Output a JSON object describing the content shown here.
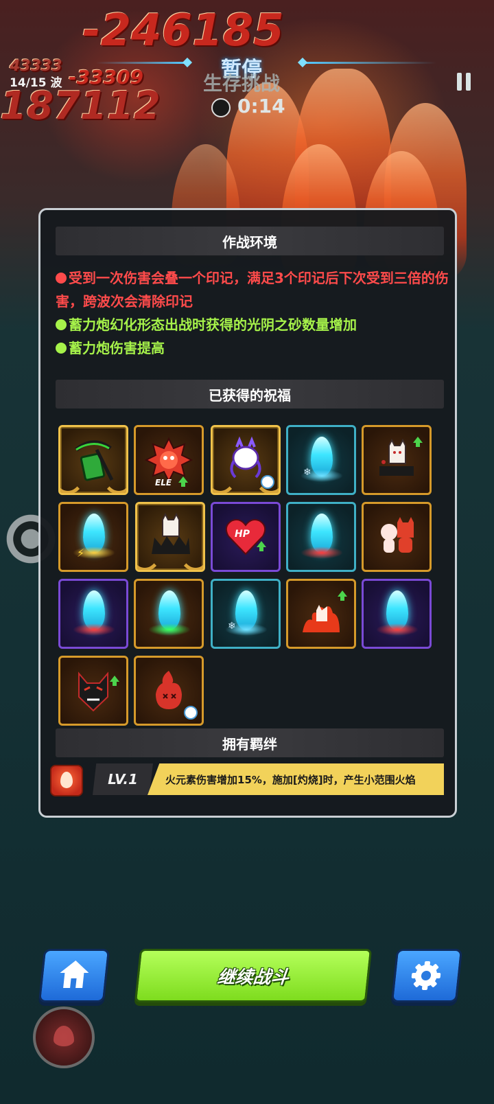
{
  "hud": {
    "damage_top": "-246185",
    "damage_left": "187112",
    "damage_small": "-33309",
    "damage_small2": "43333",
    "wave": "14/15 波",
    "paused_title": "暂停",
    "mode_title": "生存挑战",
    "timer": "0:14"
  },
  "panel": {
    "environment_title": "作战环境",
    "environment_lines": [
      {
        "text": "受到一次伤害会叠一个印记，满足3个印记后下次受到三倍的伤害，跨波次会清除印记",
        "color": "#ff4b4b"
      },
      {
        "text": "蓄力炮幻化形态出战时获得的光阴之砂数量增加",
        "color": "#a6f24a"
      },
      {
        "text": "蓄力炮伤害提高",
        "color": "#a6f24a"
      }
    ],
    "blessings_title": "已获得的祝福",
    "blessings": [
      {
        "icon": "scythe-book-icon",
        "frame": "gold",
        "badge": ""
      },
      {
        "icon": "ele-demon-icon",
        "frame": "orange",
        "badge": "up",
        "label": "ELE"
      },
      {
        "icon": "ghost-mask-icon",
        "frame": "gold",
        "badge": "clock"
      },
      {
        "icon": "ice-comet-icon",
        "frame": "teal",
        "badge": ""
      },
      {
        "icon": "cat-podium-icon",
        "frame": "orange",
        "badge": "up"
      },
      {
        "icon": "thunder-comet-icon",
        "frame": "orange",
        "badge": ""
      },
      {
        "icon": "cat-throne-icon",
        "frame": "gold",
        "badge": ""
      },
      {
        "icon": "hp-heart-icon",
        "frame": "purple",
        "badge": "up",
        "label": "HP"
      },
      {
        "icon": "fire-comet-icon",
        "frame": "teal",
        "badge": ""
      },
      {
        "icon": "duo-friends-icon",
        "frame": "orange",
        "badge": ""
      },
      {
        "icon": "fire-comet-icon",
        "frame": "purple",
        "badge": ""
      },
      {
        "icon": "poison-comet-icon",
        "frame": "orange",
        "badge": ""
      },
      {
        "icon": "ice-comet-icon",
        "frame": "teal",
        "badge": ""
      },
      {
        "icon": "fire-fox-icon",
        "frame": "orange",
        "badge": "up"
      },
      {
        "icon": "fire-comet-icon",
        "frame": "purple",
        "badge": ""
      },
      {
        "icon": "fox-mask-icon",
        "frame": "orange",
        "badge": "up"
      },
      {
        "icon": "fire-spirit-icon",
        "frame": "orange",
        "badge": "clock"
      }
    ],
    "bonds_title": "拥有羁绊",
    "bond": {
      "level": "LV.1",
      "description": "火元素伤害增加15%，施加[灼烧]时，产生小范围火焰"
    }
  },
  "buttons": {
    "continue_label": "继续战斗",
    "home_icon": "home-icon",
    "settings_icon": "gear-icon"
  }
}
